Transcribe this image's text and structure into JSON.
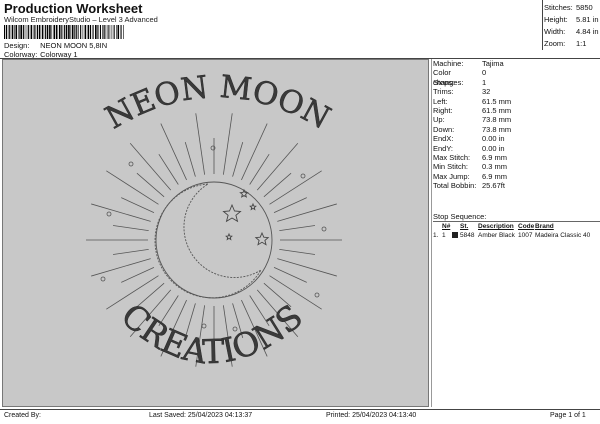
{
  "header": {
    "title": "Production Worksheet",
    "subtitle": "Wilcom EmbroideryStudio – Level 3 Advanced",
    "design_label": "Design:",
    "design_value": "NEON MOON 5,8IN",
    "colorway_label": "Colorway:",
    "colorway_value": "Colorway 1"
  },
  "stats": [
    {
      "label": "Stitches:",
      "value": "5850"
    },
    {
      "label": "Height:",
      "value": "5.81 in"
    },
    {
      "label": "Width:",
      "value": "4.84 in"
    },
    {
      "label": "Zoom:",
      "value": "1:1"
    }
  ],
  "design_info": [
    {
      "label": "Machine:",
      "value": "Tajima"
    },
    {
      "label": "Color changes:",
      "value": "0"
    },
    {
      "label": "Stops:",
      "value": "1"
    },
    {
      "label": "Trims:",
      "value": "32"
    },
    {
      "label": "Left:",
      "value": "61.5 mm"
    },
    {
      "label": "Right:",
      "value": "61.5 mm"
    },
    {
      "label": "Up:",
      "value": "73.8 mm"
    },
    {
      "label": "Down:",
      "value": "73.8 mm"
    },
    {
      "label": "EndX:",
      "value": "0.00 in"
    },
    {
      "label": "EndY:",
      "value": "0.00 in"
    },
    {
      "label": "Max Stitch:",
      "value": "6.9 mm"
    },
    {
      "label": "Min Stitch:",
      "value": "0.3 mm"
    },
    {
      "label": "Max Jump:",
      "value": "6.9 mm"
    },
    {
      "label": "Total Bobbin:",
      "value": "25.67ft"
    }
  ],
  "stop_sequence": {
    "heading": "Stop Sequence:",
    "columns": [
      "",
      "N#",
      "",
      "St.",
      "Description",
      "Code",
      "Brand"
    ],
    "rows": [
      {
        "stop": "1.",
        "n": "1",
        "stitches": "5848",
        "description": "Amber Black",
        "code": "1007",
        "brand": "Madeira Classic 40",
        "color": "#222222"
      }
    ]
  },
  "artwork": {
    "top_text": "NEON MOON",
    "bottom_text": "CREATIONS",
    "thread_color": "#3a3a3a",
    "background": "#c8c8c8"
  },
  "footer": {
    "created_by": "Created By:",
    "last_saved": "Last Saved: 25/04/2023 04:13:37",
    "printed": "Printed: 25/04/2023 04:13:40",
    "page": "Page 1 of 1"
  }
}
